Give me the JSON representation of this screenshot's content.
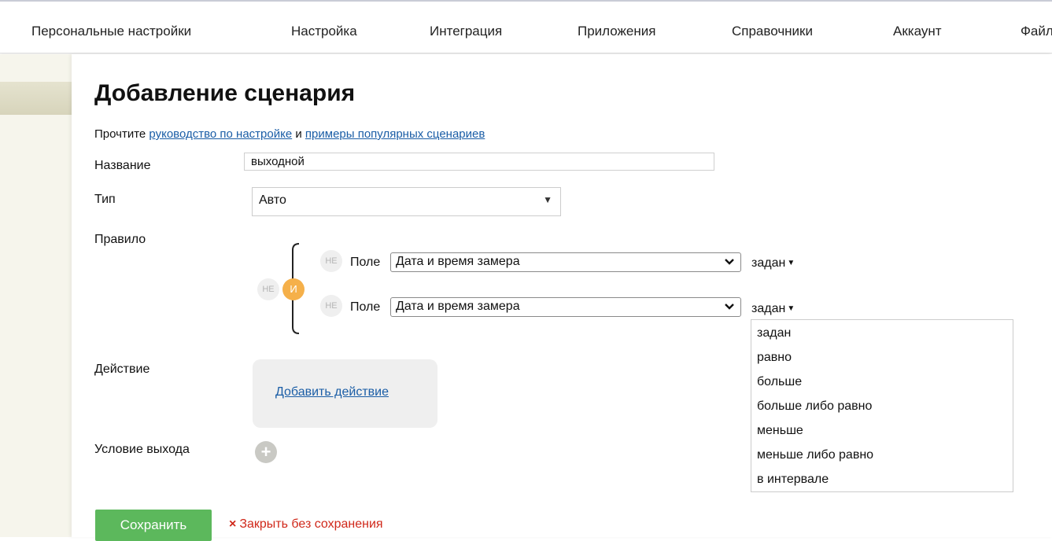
{
  "nav": {
    "items": [
      {
        "label": "Персональные настройки"
      },
      {
        "label": "Настройка"
      },
      {
        "label": "Интеграция"
      },
      {
        "label": "Приложения"
      },
      {
        "label": "Справочники"
      },
      {
        "label": "Аккаунт"
      },
      {
        "label": "Файл"
      }
    ]
  },
  "page": {
    "title": "Добавление сценария",
    "intro_prefix": "Прочтите ",
    "intro_link1": "руководство по настройке",
    "intro_middle": " и ",
    "intro_link2": "примеры популярных сценариев"
  },
  "form": {
    "name_label": "Название",
    "name_value": "выходной",
    "type_label": "Тип",
    "type_value": "Авто",
    "rule_label": "Правило",
    "action_label": "Действие",
    "add_action": "Добавить действие",
    "exit_label": "Условие выхода",
    "save": "Сохранить",
    "close": "Закрыть без сохранения",
    "close_icon": "×"
  },
  "rule": {
    "group_not": "НЕ",
    "group_op": "И",
    "conditions": [
      {
        "not": "НЕ",
        "field_label": "Поле",
        "field": "Дата и время замера",
        "operator": "задан"
      },
      {
        "not": "НЕ",
        "field_label": "Поле",
        "field": "Дата и время замера",
        "operator": "задан"
      }
    ]
  },
  "operator_dropdown": {
    "options": [
      "задан",
      "равно",
      "больше",
      "больше либо равно",
      "меньше",
      "меньше либо равно",
      "в интервале"
    ]
  },
  "icons": {
    "add_exit": "plus-icon",
    "close": "close-icon",
    "select_chevron": "chevron-down-icon"
  },
  "colors": {
    "link": "#1a5da6",
    "save_button": "#5cb85c",
    "close_link": "#d0281a",
    "and_badge": "#f5b04a"
  }
}
